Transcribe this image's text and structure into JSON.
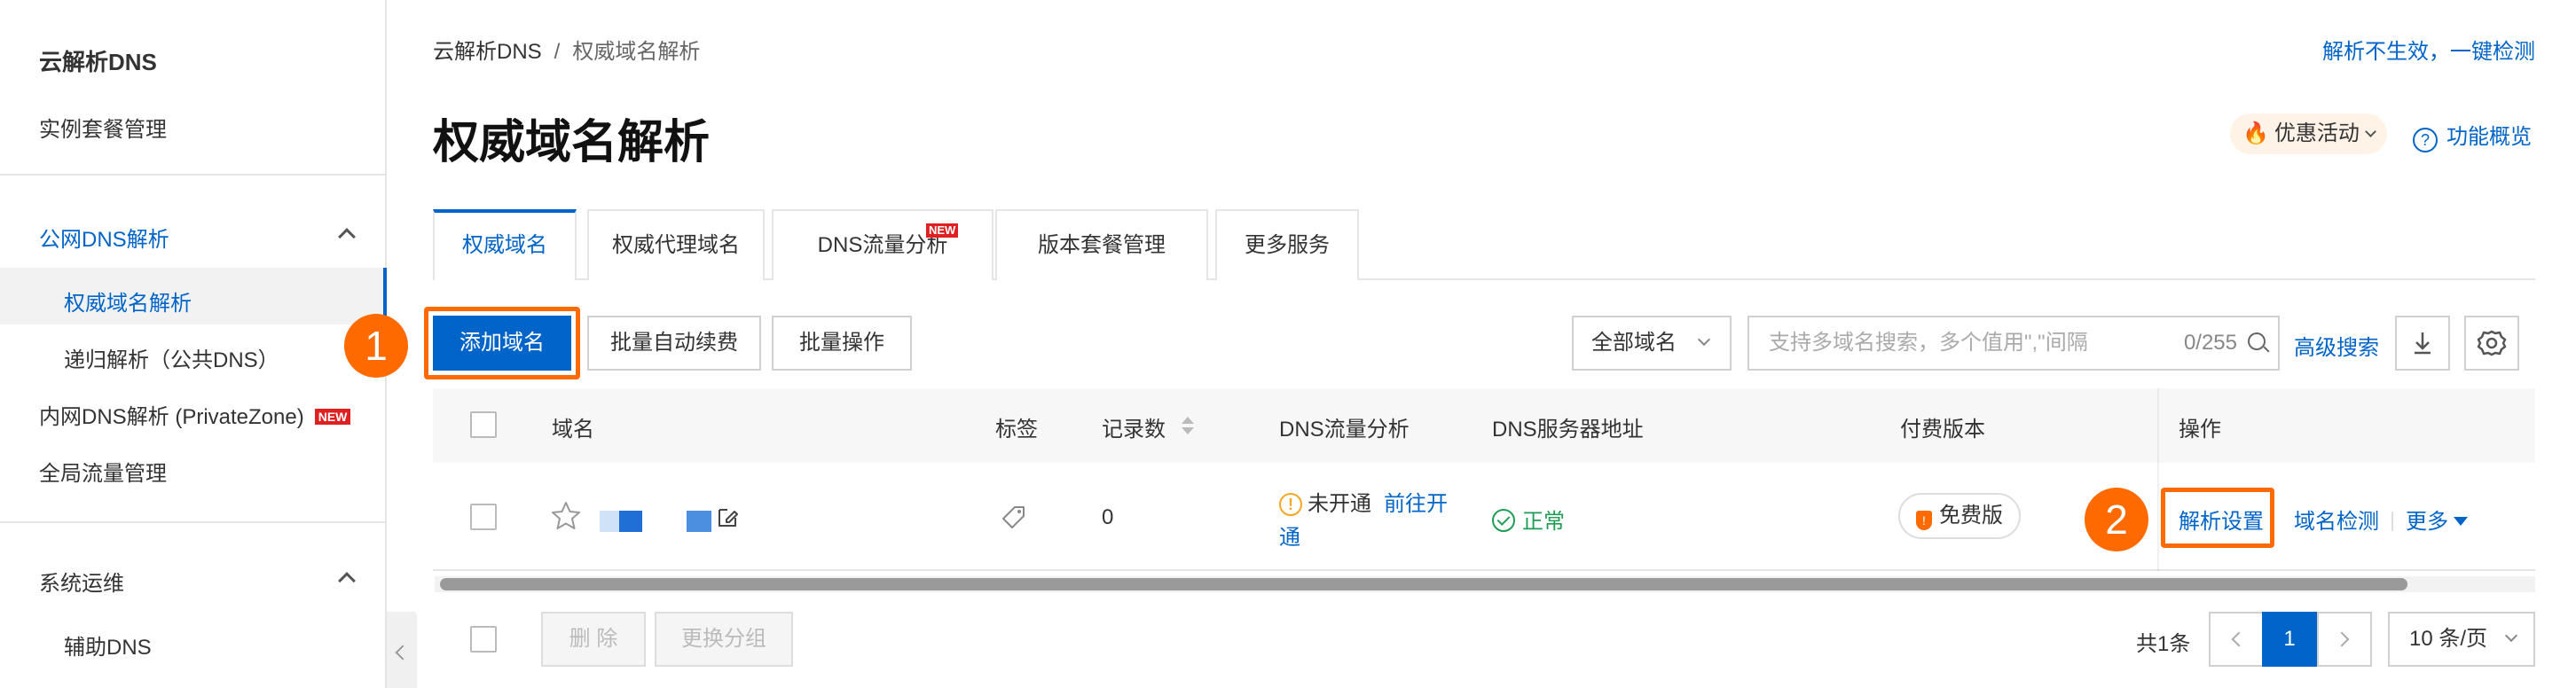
{
  "sidebar": {
    "title": "云解析DNS",
    "items": [
      {
        "label": "实例套餐管理"
      },
      {
        "label": "公网DNS解析"
      },
      {
        "label": "权威域名解析"
      },
      {
        "label": "递归解析（公共DNS）"
      },
      {
        "label": "内网DNS解析 (PrivateZone)",
        "badge": "NEW"
      },
      {
        "label": "全局流量管理"
      },
      {
        "label": "系统运维"
      },
      {
        "label": "辅助DNS"
      }
    ]
  },
  "breadcrumb": {
    "root": "云解析DNS",
    "separator": "/",
    "current": "权威域名解析"
  },
  "header": {
    "top_link": "解析不生效，一键检测",
    "title": "权威域名解析",
    "promo": "优惠活动",
    "overview": "功能概览"
  },
  "tabs": [
    {
      "label": "权威域名"
    },
    {
      "label": "权威代理域名"
    },
    {
      "label": "DNS流量分析",
      "badge": "NEW"
    },
    {
      "label": "版本套餐管理"
    },
    {
      "label": "更多服务"
    }
  ],
  "toolbar": {
    "add_domain": "添加域名",
    "auto_renew": "批量自动续费",
    "batch_ops": "批量操作",
    "domain_filter": "全部域名",
    "search_placeholder": "支持多域名搜索，多个值用\",\"间隔",
    "search_count": "0/255",
    "advanced_search": "高级搜索"
  },
  "table": {
    "columns": [
      "域名",
      "标签",
      "记录数",
      "DNS流量分析",
      "DNS服务器地址",
      "付费版本",
      "操作"
    ],
    "rows": [
      {
        "record_count": "0",
        "traffic_status": "未开通",
        "traffic_link": "前往开",
        "traffic_link_2": "通",
        "dns_status": "正常",
        "edition": "免费版",
        "actions": {
          "resolve_settings": "解析设置",
          "domain_check": "域名检测",
          "more": "更多"
        }
      }
    ]
  },
  "footer": {
    "delete": "删 除",
    "change_group": "更换分组",
    "total": "共1条",
    "current_page": "1",
    "page_size": "10 条/页"
  },
  "annotations": {
    "step1": "1",
    "step2": "2"
  },
  "colors": {
    "accent": "#0064c8",
    "highlight": "#ff6a00"
  }
}
